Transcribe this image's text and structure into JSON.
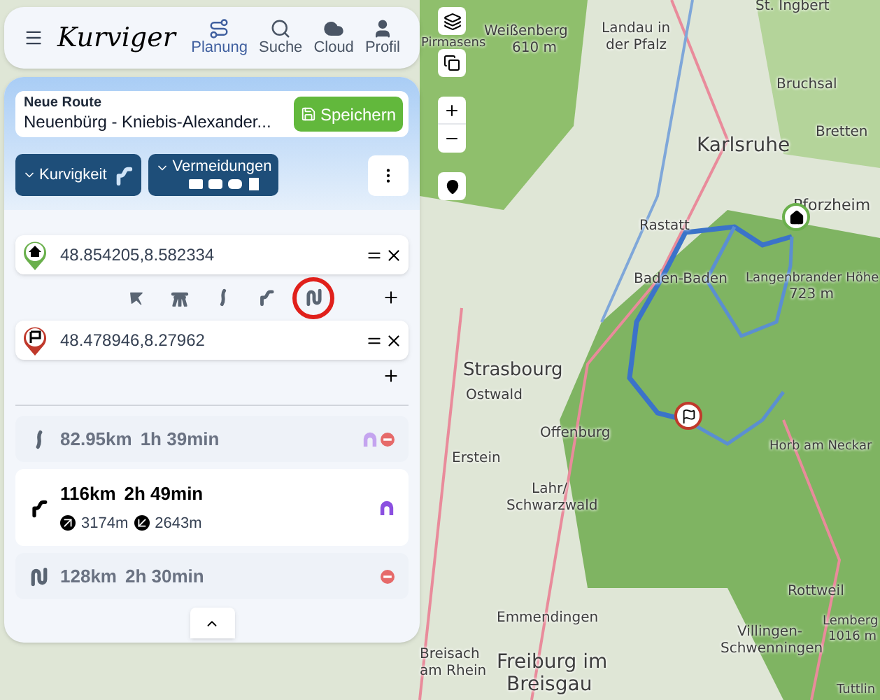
{
  "header": {
    "logo": "Kurviger",
    "nav": [
      {
        "label": "Planung",
        "selected": true
      },
      {
        "label": "Suche",
        "selected": false
      },
      {
        "label": "Cloud",
        "selected": false
      },
      {
        "label": "Profil",
        "selected": false
      }
    ]
  },
  "route": {
    "title": "Neue Route",
    "name": "Neuenbürg - Kniebis-Alexander...",
    "save": "Speichern"
  },
  "options": {
    "curviness": "Kurvigkeit",
    "avoid": "Vermeidungen"
  },
  "waypoints": [
    {
      "kind": "start",
      "value": "48.854205,8.582334"
    },
    {
      "kind": "finish",
      "value": "48.478946,8.27962"
    }
  ],
  "route_types": [
    {
      "kind": "fastest",
      "selected": false
    },
    {
      "kind": "motorway",
      "selected": false
    },
    {
      "kind": "curvy",
      "selected": false
    },
    {
      "kind": "curvier",
      "selected": false
    },
    {
      "kind": "curviest",
      "selected": true
    }
  ],
  "alternatives": [
    {
      "kind": "curvy",
      "distance": "82.95km",
      "duration": "1h 39min",
      "selected": false,
      "tunnel": true,
      "restricted": true
    },
    {
      "kind": "curvier",
      "distance": "116km",
      "duration": "2h 49min",
      "ascent": "3174m",
      "descent": "2643m",
      "selected": true,
      "tunnel": true,
      "restricted": false
    },
    {
      "kind": "curviest",
      "distance": "128km",
      "duration": "2h 30min",
      "selected": false,
      "tunnel": false,
      "restricted": true
    }
  ],
  "map": {
    "labels": [
      "St. Ingbert",
      "Weißenberg",
      "610 m",
      "Pirmasens",
      "Landau in",
      "der Pfalz",
      "Bruchsal",
      "Bretten",
      "Karlsruhe",
      "Pforzheim",
      "Rastatt",
      "Baden-Baden",
      "Langenbrander Höhe",
      "723 m",
      "Strasbourg",
      "Ostwald",
      "Offenburg",
      "Erstein",
      "Lahr/",
      "Schwarzwald",
      "Horb am Neckar",
      "Rottweil",
      "Lemberg",
      "1016 m",
      "Emmendingen",
      "Villingen-",
      "Breisach",
      "Freiburg im",
      "Schwenningen",
      "am Rhein",
      "Breisgau",
      "Tuttlin"
    ]
  }
}
